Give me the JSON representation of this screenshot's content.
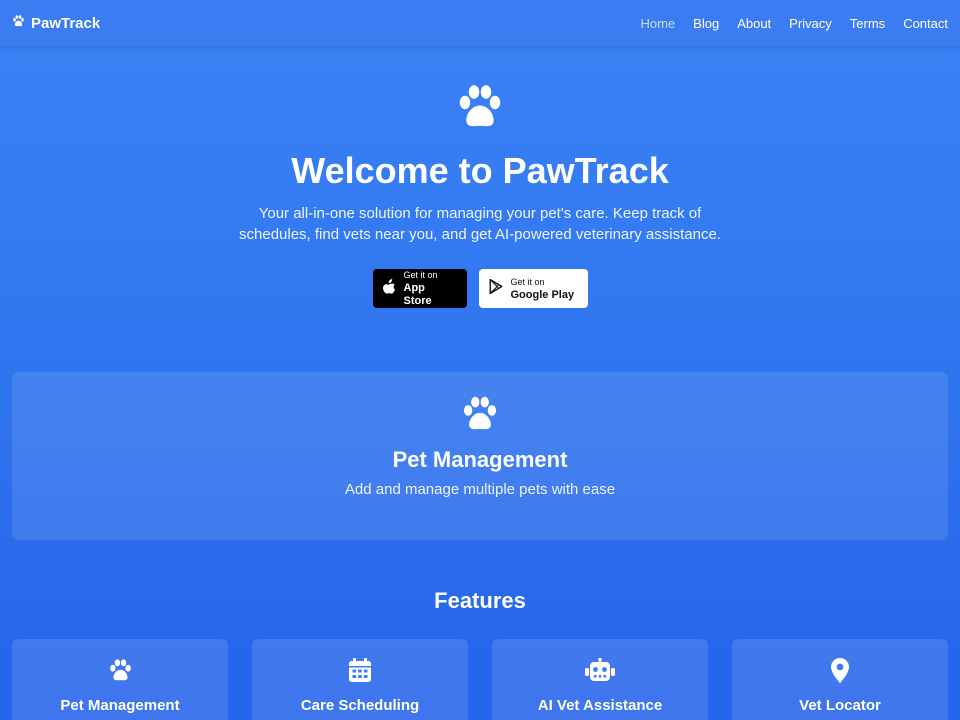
{
  "nav": {
    "brand": "PawTrack",
    "brand_icon": "paw-icon",
    "links": [
      {
        "label": "Home",
        "active": true
      },
      {
        "label": "Blog",
        "active": false
      },
      {
        "label": "About",
        "active": false
      },
      {
        "label": "Privacy",
        "active": false
      },
      {
        "label": "Terms",
        "active": false
      },
      {
        "label": "Contact",
        "active": false
      }
    ]
  },
  "hero": {
    "icon": "paw-icon",
    "title": "Welcome to PawTrack",
    "subtitle": "Your all-in-one solution for managing your pet's care. Keep track of schedules, find vets near you, and get AI-powered veterinary assistance.",
    "app_store": {
      "small": "Get it on",
      "big": "App Store",
      "icon": "apple-icon"
    },
    "google_play": {
      "small": "Get it on",
      "big": "Google Play",
      "icon": "play-icon"
    }
  },
  "showcase": {
    "icon": "paw-icon",
    "title": "Pet Management",
    "description": "Add and manage multiple pets with ease"
  },
  "features": {
    "heading": "Features",
    "items": [
      {
        "title": "Pet Management",
        "icon": "paw-icon"
      },
      {
        "title": "Care Scheduling",
        "icon": "calendar-icon"
      },
      {
        "title": "AI Vet Assistance",
        "icon": "robot-icon"
      },
      {
        "title": "Vet Locator",
        "icon": "map-pin-icon"
      }
    ]
  },
  "colors": {
    "background_top": "#3b82f6",
    "background_bottom": "#2563eb",
    "nav_active": "#c8dcff"
  }
}
